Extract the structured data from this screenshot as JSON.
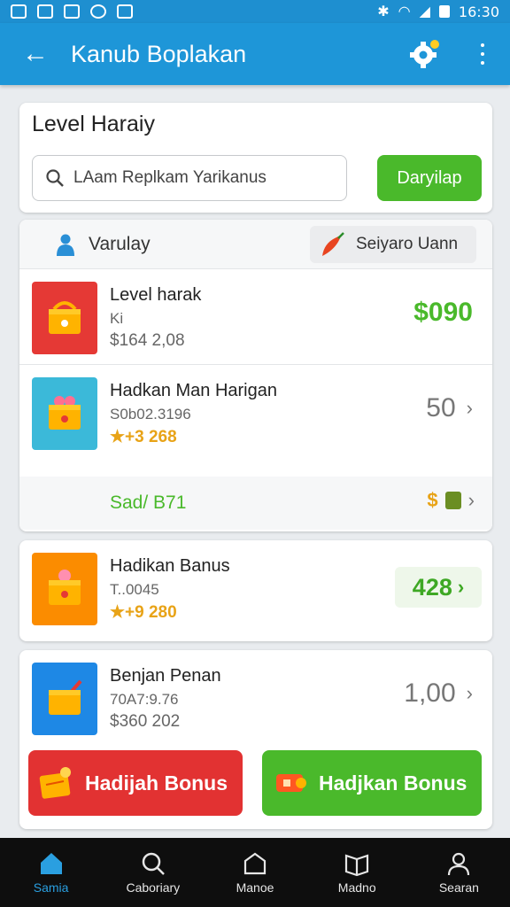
{
  "status_bar": {
    "time": "16:30"
  },
  "app_bar": {
    "title": "Kanub Boplakan"
  },
  "search_card": {
    "heading": "Level Haraiy",
    "search_text": "LAam Replkam Yarikanus",
    "button_label": "Daryilap"
  },
  "list_header": {
    "left_label": "Varulay",
    "chip_label": "Seiyaro Uann"
  },
  "items": [
    {
      "title": "Level harak",
      "line2": "Ki",
      "line3": "$164 2,08",
      "price": "$090"
    },
    {
      "title": "Hadkan Man Harigan",
      "line2": "S0b02.3196",
      "line3": "★+3 268",
      "price": "50",
      "sub_label": "Sad/ B71"
    },
    {
      "title": "Hadikan Banus",
      "line2": "T..0045",
      "line3": "★+9 280",
      "price": "428"
    },
    {
      "title": "Benjan Penan",
      "line2": "70A7:9.76",
      "line3": "$360 202",
      "price": "1,00"
    }
  ],
  "buttons": {
    "red_label": "Hadijah Bonus",
    "green_label": "Hadjkan Bonus"
  },
  "bottom_nav": [
    {
      "label": "Samia",
      "icon": "home-icon"
    },
    {
      "label": "Caboriary",
      "icon": "search-icon"
    },
    {
      "label": "Manoe",
      "icon": "box-icon"
    },
    {
      "label": "Madno",
      "icon": "book-icon"
    },
    {
      "label": "Searan",
      "icon": "person-icon"
    }
  ],
  "colors": {
    "primary": "#1e96d8",
    "accent_green": "#4ab92b",
    "accent_red": "#e23232"
  }
}
